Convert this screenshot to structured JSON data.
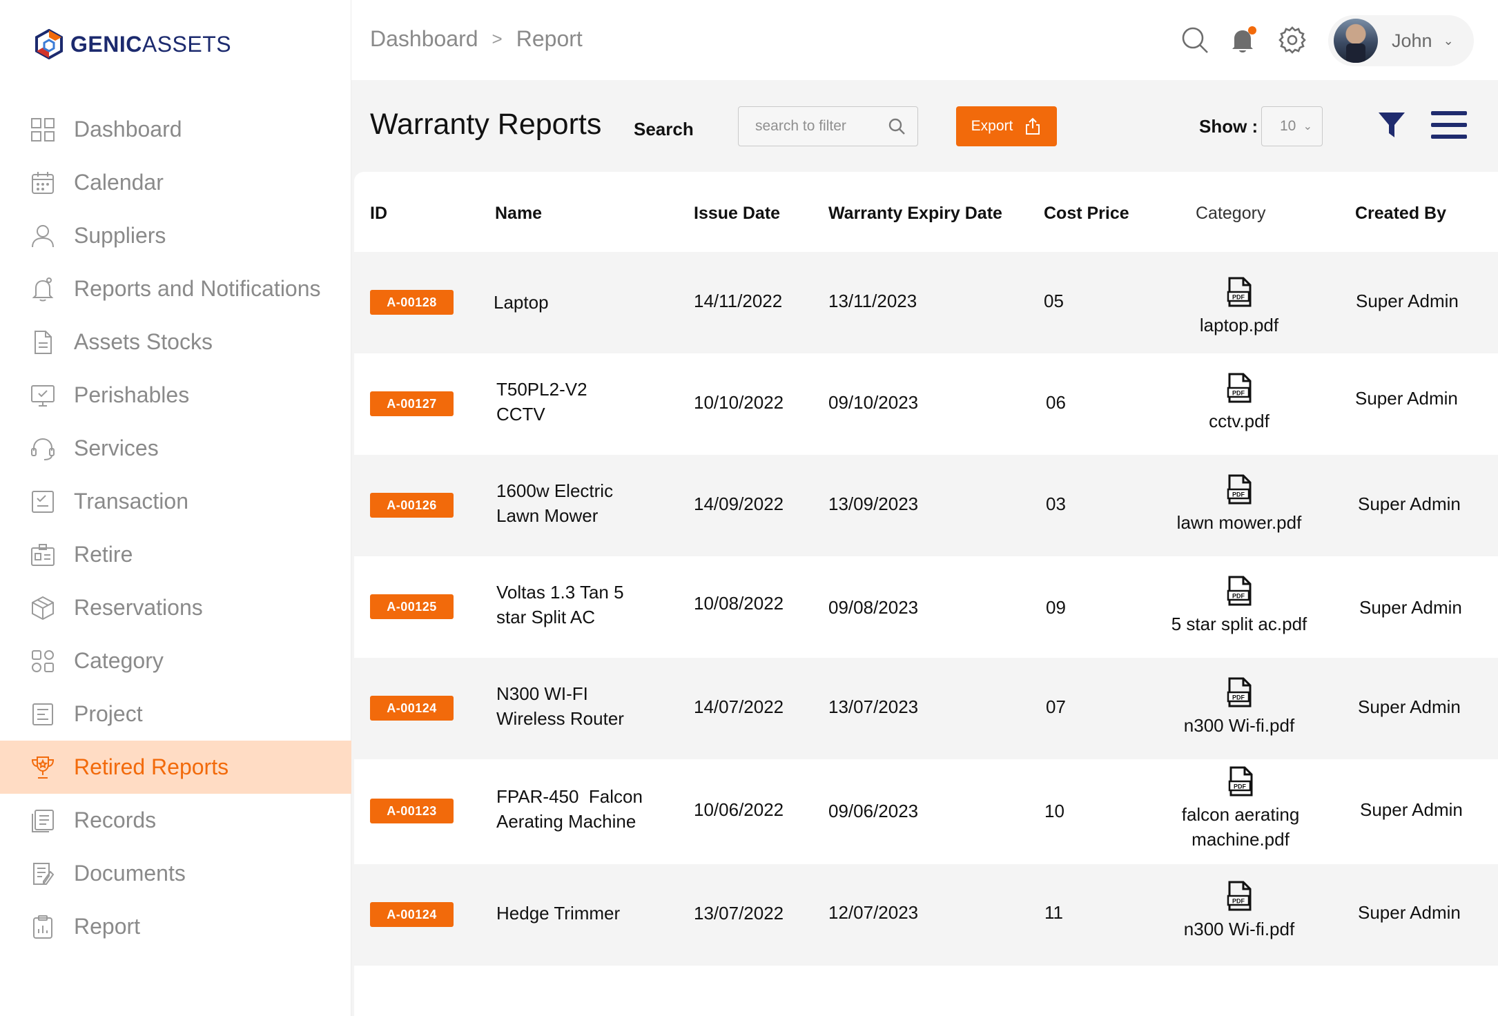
{
  "brand": {
    "logo_bold": "GENIC",
    "logo_light": "ASSETS"
  },
  "breadcrumb": {
    "first": "Dashboard",
    "separator": ">",
    "current": "Report"
  },
  "user": {
    "name": "John"
  },
  "sidebar": {
    "items": [
      {
        "label": "Dashboard",
        "icon": "grid-icon"
      },
      {
        "label": "Calendar",
        "icon": "calendar-icon"
      },
      {
        "label": "Suppliers",
        "icon": "user-icon"
      },
      {
        "label": "Reports and Notifications",
        "icon": "bell-icon"
      },
      {
        "label": "Assets Stocks",
        "icon": "document-icon"
      },
      {
        "label": "Perishables",
        "icon": "monitor-check-icon"
      },
      {
        "label": "Services",
        "icon": "headset-icon"
      },
      {
        "label": "Transaction",
        "icon": "checklist-icon"
      },
      {
        "label": "Retire",
        "icon": "id-card-icon"
      },
      {
        "label": "Reservations",
        "icon": "box-icon"
      },
      {
        "label": "Category",
        "icon": "shapes-icon"
      },
      {
        "label": "Project",
        "icon": "list-box-icon"
      },
      {
        "label": "Retired Reports",
        "icon": "trophy-icon",
        "active": true
      },
      {
        "label": "Records",
        "icon": "records-icon"
      },
      {
        "label": "Documents",
        "icon": "documents-icon"
      },
      {
        "label": "Report",
        "icon": "clipboard-icon"
      }
    ]
  },
  "toolbar": {
    "title": "Warranty Reports",
    "search_label": "Search",
    "search_placeholder": "search to filter",
    "export_label": "Export",
    "show_label": "Show :",
    "show_value": "10"
  },
  "table": {
    "headers": [
      "ID",
      "Name",
      "Issue Date",
      "Warranty Expiry Date",
      "Cost Price",
      "Category",
      "Created By"
    ],
    "rows": [
      {
        "id": "A-00128",
        "name": [
          "Laptop"
        ],
        "issue": "14/11/2022",
        "expiry": "13/11/2023",
        "cost": "05",
        "file": [
          "laptop.pdf"
        ],
        "created_by": "Super Admin"
      },
      {
        "id": "A-00127",
        "name": [
          "T50PL2-V2",
          "CCTV"
        ],
        "issue": "10/10/2022",
        "expiry": "09/10/2023",
        "cost": "06",
        "file": [
          "cctv.pdf"
        ],
        "created_by": "Super Admin"
      },
      {
        "id": "A-00126",
        "name": [
          "1600w Electric",
          "Lawn Mower"
        ],
        "issue": "14/09/2022",
        "expiry": "13/09/2023",
        "cost": "03",
        "file": [
          "lawn mower.pdf"
        ],
        "created_by": "Super Admin"
      },
      {
        "id": "A-00125",
        "name": [
          "Voltas 1.3 Tan 5",
          "star Split AC"
        ],
        "issue": "10/08/2022",
        "expiry": "09/08/2023",
        "cost": "09",
        "file": [
          "5 star split ac.pdf"
        ],
        "created_by": "Super Admin"
      },
      {
        "id": "A-00124",
        "name": [
          "N300 WI-FI",
          "Wireless Router"
        ],
        "issue": "14/07/2022",
        "expiry": "13/07/2023",
        "cost": "07",
        "file": [
          "n300 Wi-fi.pdf"
        ],
        "created_by": "Super Admin"
      },
      {
        "id": "A-00123",
        "name": [
          "FPAR-450  Falcon",
          "Aerating Machine"
        ],
        "issue": "10/06/2022",
        "expiry": "09/06/2023",
        "cost": "10",
        "file": [
          "falcon aerating",
          "machine.pdf"
        ],
        "created_by": "Super Admin"
      },
      {
        "id": "A-00124",
        "name": [
          "Hedge Trimmer"
        ],
        "issue": "13/07/2022",
        "expiry": "12/07/2023",
        "cost": "11",
        "file": [
          "n300 Wi-fi.pdf"
        ],
        "created_by": "Super Admin"
      }
    ]
  },
  "colors": {
    "accent": "#f26a0b",
    "active_bg": "#ffdcc4",
    "brand_navy": "#1c2a6e"
  }
}
